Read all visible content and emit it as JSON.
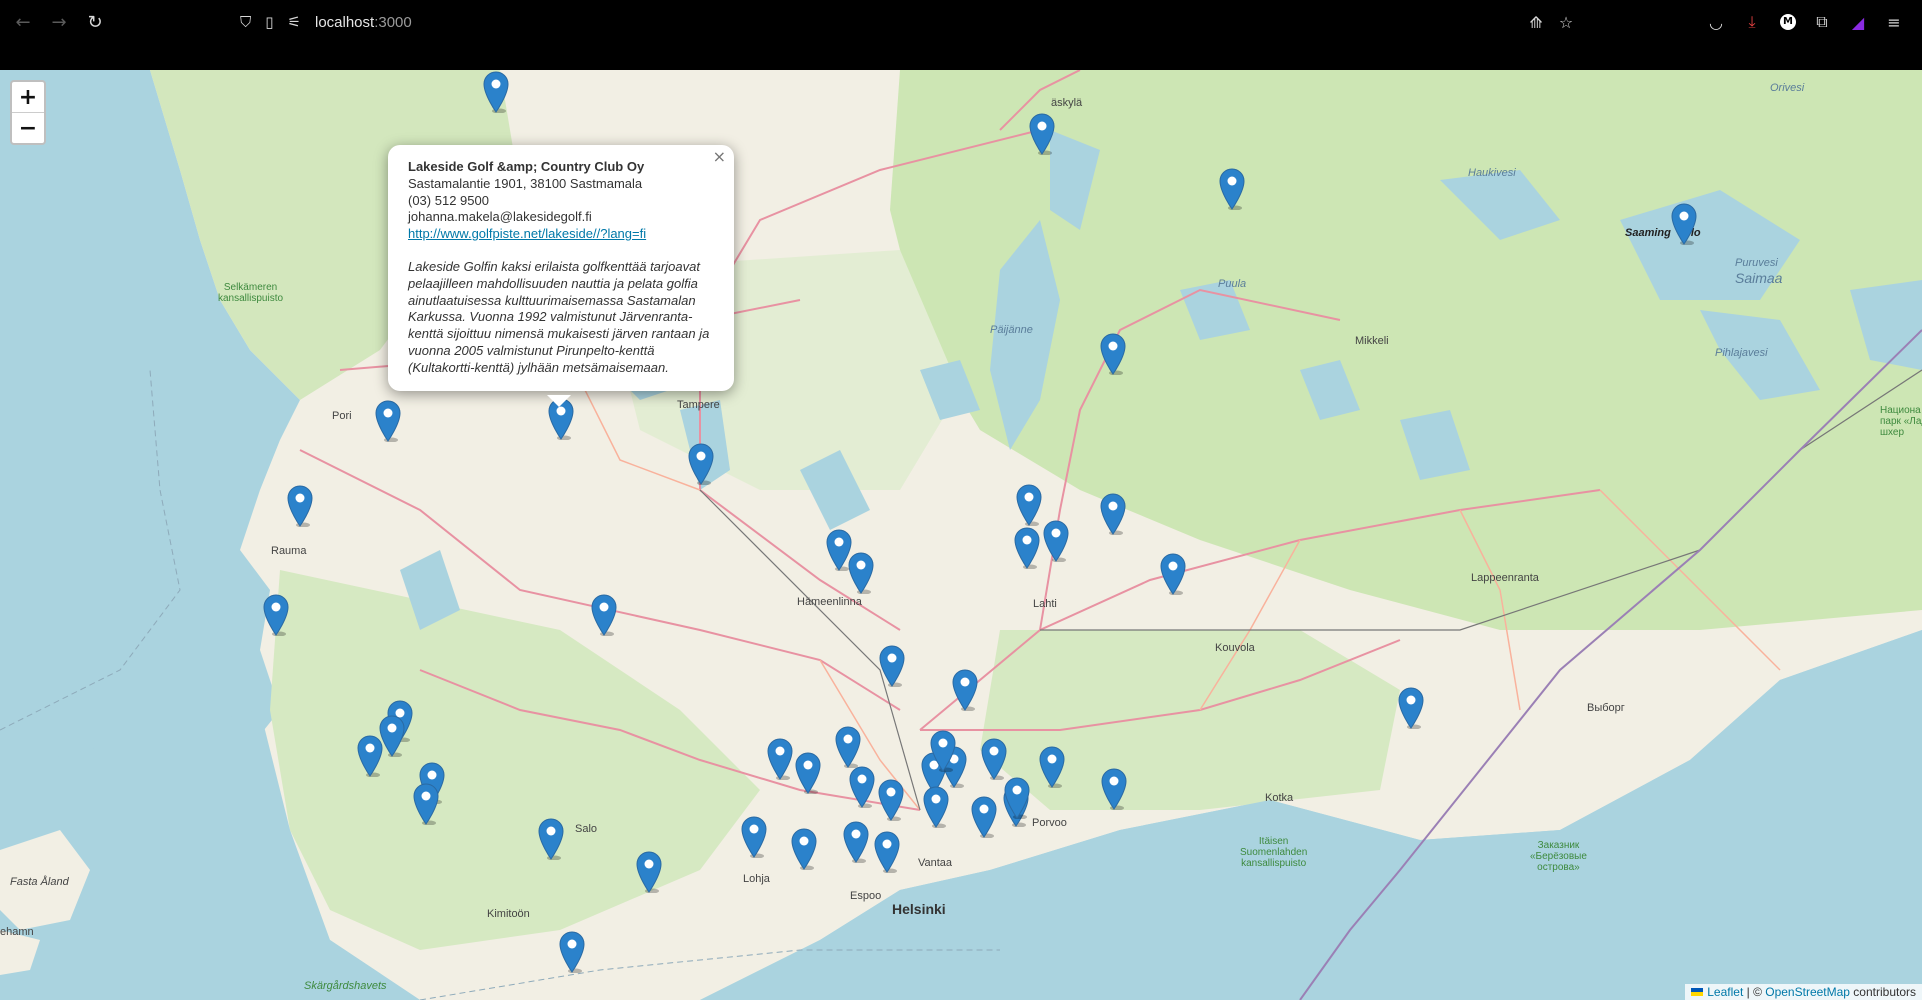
{
  "browser": {
    "url_host": "localhost",
    "url_port": ":3000"
  },
  "map": {
    "zoom_in_label": "+",
    "zoom_out_label": "−",
    "place_labels": {
      "pori": "Pori",
      "tampere": "Tampere",
      "rauma": "Rauma",
      "hameenlinna": "Hämeenlinna",
      "lahti": "Lahti",
      "kouvola": "Kouvola",
      "lappeenranta": "Lappeenranta",
      "mikkeli": "Mikkeli",
      "jyvaskyla": "äskylä",
      "saaminglo": "Saaming",
      "saaming_tail": "lo",
      "vyborg": "Выборг",
      "kotka": "Kotka",
      "porvoo": "Porvoo",
      "vantaa": "Vantaa",
      "espoo": "Espoo",
      "helsinki": "Helsinki",
      "lohja": "Lohja",
      "salo": "Salo",
      "kimitoon": "Kimitoön",
      "fasta_aland": "Fasta Åland",
      "ehamn": "ehamn",
      "paijanne": "Päijänne",
      "saimaa": "Saimaa",
      "puula": "Puula",
      "haukivesi": "Haukivesi",
      "puruvesi": "Puruvesi",
      "pihlajavesi": "Pihlajavesi",
      "orivesi": "Orivesi",
      "skargardshavets": "Skärgårdshavets",
      "selkameren": "Selkämeren\nkansallispuisto",
      "itainen": "Itäisen\nSuomenlahden\nkansallispuisto",
      "zakaznik": "Заказник\n«Берёзовые\nострова»",
      "ladoga_park": "Национа\nпарк «Лад\nшхер"
    },
    "marker_count": 48,
    "markers_icon": "map-pin-marker-icon",
    "marker_color": "#2b82cb"
  },
  "popup": {
    "title": "Lakeside Golf &amp; Country Club Oy",
    "address": "Sastamalantie 1901, 38100 Sastmamala",
    "phone": "(03) 512 9500",
    "email": "johanna.makela@lakesidegolf.fi",
    "link": "http://www.golfpiste.net/lakeside//?lang=fi",
    "description": "Lakeside Golfin kaksi erilaista golfkenttää tarjoavat pelaajilleen mahdollisuuden nauttia ja pelata golfia ainutlaatuisessa kulttuurimaisemassa Sastamalan Karkussa. Vuonna 1992 valmistunut Järvenranta-kenttä sijoittuu nimensä mukaisesti järven rantaan ja vuonna 2005 valmistunut Pirunpelto-kenttä (Kultakortti-kenttä) jylhään metsämaisemaan.",
    "close_label": "×"
  },
  "attribution": {
    "leaflet": "Leaflet",
    "separator": " | © ",
    "osm": "OpenStreetMap",
    "contributors": " contributors"
  }
}
